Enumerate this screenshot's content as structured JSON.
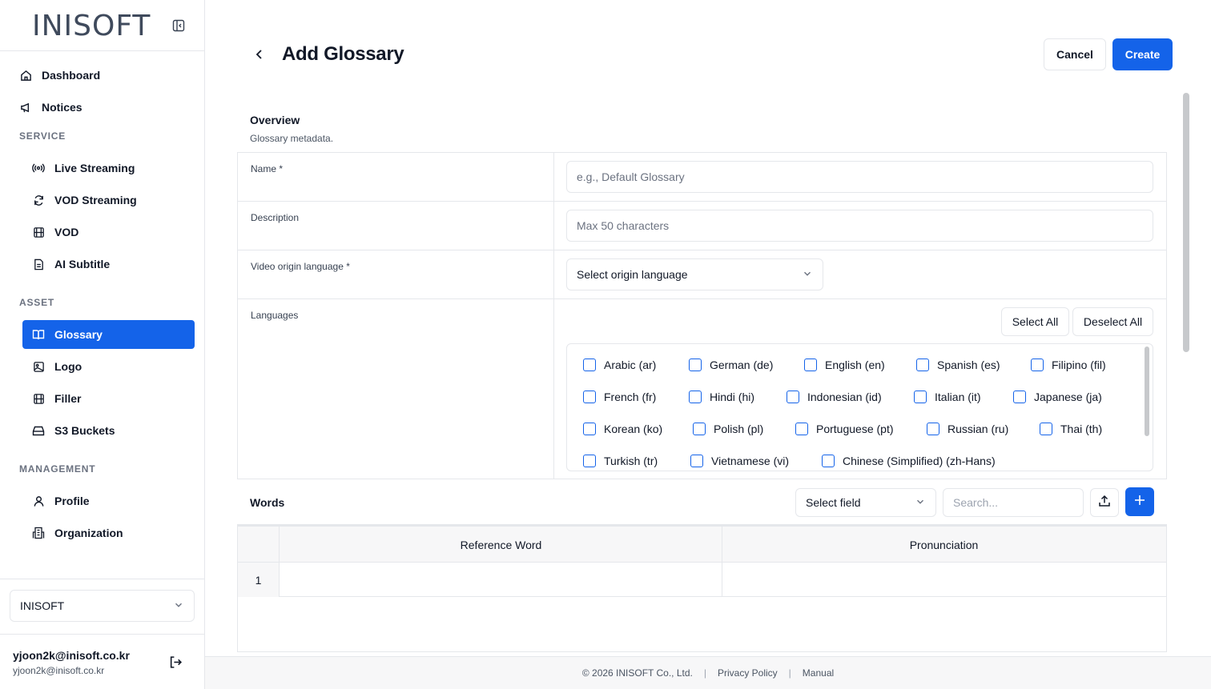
{
  "sidebar": {
    "logo": "INISOFT",
    "collapse_icon": "sidebar-collapse-icon",
    "items": [
      {
        "label": "Dashboard",
        "icon": "home-icon"
      },
      {
        "label": "Notices",
        "icon": "megaphone-icon"
      }
    ],
    "sections": [
      {
        "label": "SERVICE",
        "items": [
          {
            "label": "Live Streaming",
            "icon": "broadcast-icon"
          },
          {
            "label": "VOD Streaming",
            "icon": "refresh-icon"
          },
          {
            "label": "VOD",
            "icon": "film-icon"
          },
          {
            "label": "AI Subtitle",
            "icon": "document-icon"
          }
        ]
      },
      {
        "label": "ASSET",
        "items": [
          {
            "label": "Glossary",
            "icon": "book-open-icon",
            "active": true
          },
          {
            "label": "Logo",
            "icon": "image-icon"
          },
          {
            "label": "Filler",
            "icon": "film-icon"
          },
          {
            "label": "S3 Buckets",
            "icon": "storage-icon"
          }
        ]
      },
      {
        "label": "MANAGEMENT",
        "items": [
          {
            "label": "Profile",
            "icon": "user-icon"
          },
          {
            "label": "Organization",
            "icon": "building-icon"
          }
        ]
      }
    ],
    "organization": "INISOFT",
    "user": {
      "name": "yjoon2k@inisoft.co.kr",
      "email": "yjoon2k@inisoft.co.kr"
    }
  },
  "header": {
    "title": "Add Glossary",
    "cancel_label": "Cancel",
    "create_label": "Create"
  },
  "overview": {
    "title": "Overview",
    "subtitle": "Glossary metadata.",
    "name_label": "Name *",
    "name_placeholder": "e.g., Default Glossary",
    "description_label": "Description",
    "description_placeholder": "Max 50 characters",
    "origin_label": "Video origin language *",
    "origin_placeholder": "Select origin language",
    "languages_label": "Languages",
    "select_all_label": "Select All",
    "deselect_all_label": "Deselect All",
    "languages": [
      "Arabic (ar)",
      "German (de)",
      "English (en)",
      "Spanish (es)",
      "Filipino (fil)",
      "French (fr)",
      "Hindi (hi)",
      "Indonesian (id)",
      "Italian (it)",
      "Japanese (ja)",
      "Korean (ko)",
      "Polish (pl)",
      "Portuguese (pt)",
      "Russian (ru)",
      "Thai (th)",
      "Turkish (tr)",
      "Vietnamese (vi)",
      "Chinese (Simplified) (zh-Hans)"
    ]
  },
  "words": {
    "title": "Words",
    "field_select": "Select field",
    "search_placeholder": "Search...",
    "columns": [
      "Reference Word",
      "Pronunciation"
    ],
    "rows": [
      {
        "num": "1",
        "reference": "",
        "pronunciation": ""
      }
    ]
  },
  "footer": {
    "copyright": "© 2026 INISOFT Co., Ltd.",
    "privacy": "Privacy Policy",
    "manual": "Manual"
  },
  "colors": {
    "accent": "#1463e9",
    "border": "#e5e7eb",
    "muted": "#6b7280"
  }
}
